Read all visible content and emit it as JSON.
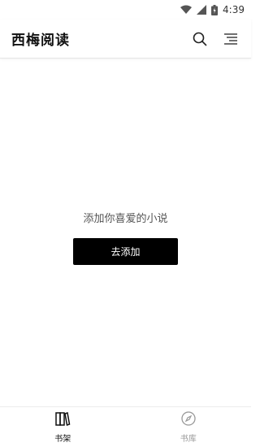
{
  "status_bar": {
    "time": "4:39",
    "icons": [
      "wifi-icon",
      "signal-icon",
      "battery-icon"
    ]
  },
  "app_bar": {
    "title": "西梅阅读",
    "actions": [
      {
        "icon": "search-icon"
      },
      {
        "icon": "menu-icon"
      }
    ]
  },
  "empty_state": {
    "message": "添加你喜爱的小说",
    "button_label": "去添加"
  },
  "bottom_nav": {
    "items": [
      {
        "label": "书架",
        "icon": "bookshelf-icon",
        "active": true
      },
      {
        "label": "书库",
        "icon": "compass-icon",
        "active": false
      }
    ]
  },
  "colors": {
    "accent": "#000000",
    "inactive": "#999999",
    "background": "#ffffff"
  }
}
